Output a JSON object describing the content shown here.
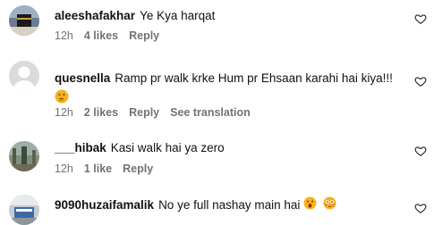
{
  "comments": [
    {
      "username": "aleeshafakhar",
      "text": "Ye Kya harqat",
      "time": "12h",
      "likes": "4 likes",
      "reply": "Reply"
    },
    {
      "username": "quesnella",
      "text": "Ramp pr walk krke Hum pr Ehsaan karahi hai kiya!!!",
      "emoji": "thinking-face",
      "time": "12h",
      "likes": "2 likes",
      "reply": "Reply",
      "translation": "See translation"
    },
    {
      "username": "___hibak",
      "text": "Kasi walk hai ya zero",
      "time": "12h",
      "likes": "1 like",
      "reply": "Reply"
    },
    {
      "username": "9090huzaifamalik",
      "text": "No ye full nashay main hai",
      "emojis": [
        "astonished-face",
        "flushed-face"
      ]
    }
  ],
  "icons": {
    "like": "heart-outline-icon"
  },
  "colors": {
    "meta": "#737373",
    "text": "#111111"
  }
}
